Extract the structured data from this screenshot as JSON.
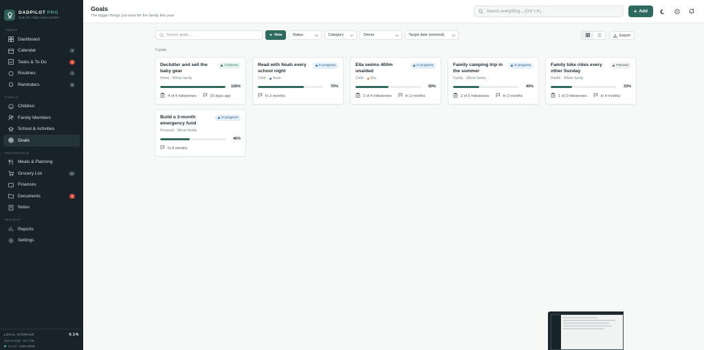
{
  "brand": {
    "name": "DADPILOT",
    "badge": "PRO",
    "tagline": "Dad Life, Fully Under Control"
  },
  "sidebar": {
    "sections": [
      {
        "title": "TODAY",
        "items": [
          {
            "label": "Dashboard",
            "icon": "grid-icon"
          },
          {
            "label": "Calendar",
            "icon": "calendar-icon",
            "badge": "3"
          },
          {
            "label": "Tasks & To-Do",
            "icon": "checkbox-icon",
            "badge": "2",
            "badge_alert": true
          },
          {
            "label": "Routines",
            "icon": "repeat-icon",
            "badge": "1"
          },
          {
            "label": "Reminders",
            "icon": "bell-icon",
            "badge": "5"
          }
        ]
      },
      {
        "title": "FAMILY",
        "items": [
          {
            "label": "Children",
            "icon": "smile-icon"
          },
          {
            "label": "Family Members",
            "icon": "users-icon"
          },
          {
            "label": "School & Activities",
            "icon": "school-icon"
          },
          {
            "label": "Goals",
            "icon": "target-icon",
            "active": true
          }
        ]
      },
      {
        "title": "HOUSEHOLD",
        "items": [
          {
            "label": "Meals & Planning",
            "icon": "utensils-icon"
          },
          {
            "label": "Grocery List",
            "icon": "cart-icon",
            "badge": "10"
          },
          {
            "label": "Finances",
            "icon": "wallet-icon"
          },
          {
            "label": "Documents",
            "icon": "folder-icon",
            "badge": "2",
            "badge_alert": true
          },
          {
            "label": "Notes",
            "icon": "note-icon"
          }
        ]
      },
      {
        "title": "INSIGHT",
        "items": [
          {
            "label": "Reports",
            "icon": "chart-icon"
          },
          {
            "label": "Settings",
            "icon": "gear-icon"
          }
        ]
      }
    ],
    "storage": {
      "label": "LOCAL STORAGE",
      "percent": "0.1%",
      "detail": "218 records · 64.7 KB",
      "version": "v1.0.0 · IndexedDB"
    }
  },
  "header": {
    "title": "Goals",
    "subtitle": "The bigger things you want for the family this year",
    "search_placeholder": "Search everything... (Ctrl + K)",
    "add_label": "Add"
  },
  "toolbar": {
    "search_placeholder": "Search goals...",
    "new_label": "New",
    "filters": [
      "Status",
      "Category",
      "Owner",
      "Target date (soonest)"
    ],
    "export_label": "Export"
  },
  "goal_count": "6 goals",
  "goals": [
    {
      "title": "Declutter and sell the baby gear",
      "status": "Achieved",
      "status_type": "achieved",
      "category": "Home",
      "owner": "Whole family",
      "progress": 100,
      "progress_label": "100%",
      "milestones": "4 of 4 milestones",
      "timing": "20 days ago"
    },
    {
      "title": "Read with Noah every school night",
      "status": "In progress",
      "status_type": "progress",
      "category": "Child",
      "owner": "Noah",
      "owner_color": "#3c77b0",
      "progress": 70,
      "progress_label": "70%",
      "milestones": "",
      "timing": "In 2 months"
    },
    {
      "title": "Ella swims 400m unaided",
      "status": "In progress",
      "status_type": "progress",
      "category": "Child",
      "owner": "Ella",
      "owner_color": "#d9823b",
      "progress": 50,
      "progress_label": "50%",
      "milestones": "2 of 4 milestones",
      "timing": "In 2 months"
    },
    {
      "title": "Family camping trip in the summer",
      "status": "In progress",
      "status_type": "progress",
      "category": "Family",
      "owner": "Whole family",
      "progress": 40,
      "progress_label": "40%",
      "milestones": "2 of 5 milestones",
      "timing": "In 3 months"
    },
    {
      "title": "Family bike rides every other Sunday",
      "status": "Planned",
      "status_type": "planned",
      "category": "Health",
      "owner": "Whole family",
      "progress": 33,
      "progress_label": "33%",
      "milestones": "1 of 3 milestones",
      "timing": "In 4 months"
    },
    {
      "title": "Build a 3-month emergency fund",
      "status": "In progress",
      "status_type": "progress",
      "category": "Financial",
      "owner": "Whole family",
      "progress": 45,
      "progress_label": "45%",
      "milestones": "",
      "timing": "In 8 months"
    }
  ],
  "colors": {
    "accent": "#2e6b5e",
    "sidebar_bg": "#182329",
    "alert": "#d8493e"
  }
}
